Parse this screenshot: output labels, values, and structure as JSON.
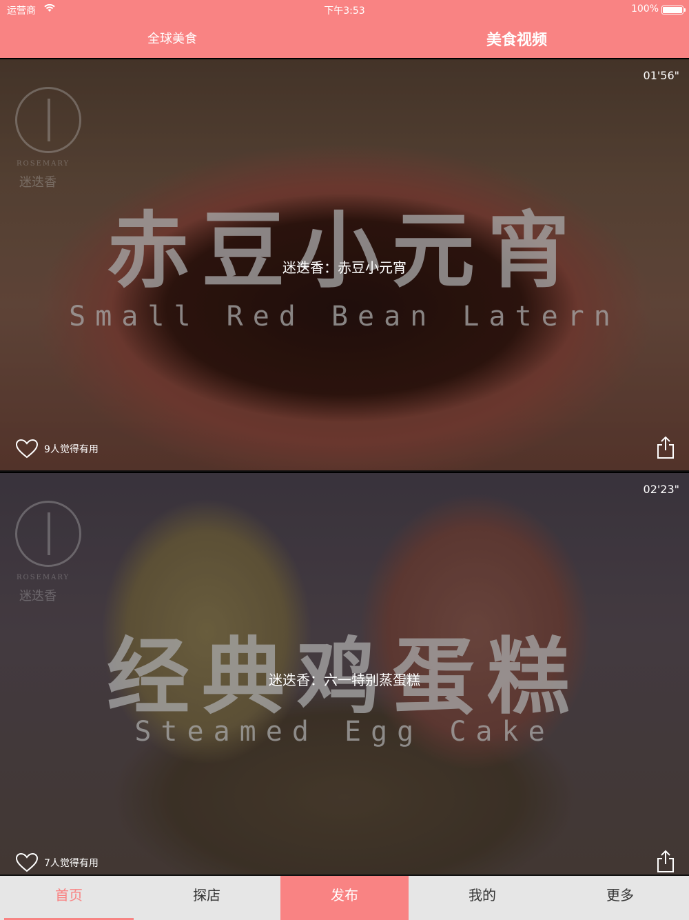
{
  "status_bar": {
    "carrier": "运营商",
    "time": "下午3:53",
    "battery": "100%"
  },
  "nav": {
    "tabs": [
      {
        "label": "全球美食"
      },
      {
        "label": "美食视频"
      }
    ],
    "active_index": 1
  },
  "videos": [
    {
      "duration": "01'56\"",
      "caption": "迷迭香：赤豆小元宵",
      "overlay_title": "赤豆小元宵",
      "overlay_subtitle": "Small Red Bean Latern",
      "watermark_en": "ROSEMARY",
      "watermark_cn": "迷迭香",
      "likes": "9人觉得有用"
    },
    {
      "duration": "02'23\"",
      "caption": "迷迭香：六一特别蒸蛋糕",
      "overlay_title": "经典鸡蛋糕",
      "overlay_subtitle": "Steamed Egg Cake",
      "watermark_en": "ROSEMARY",
      "watermark_cn": "迷迭香",
      "likes": "7人觉得有用"
    }
  ],
  "tabbar": {
    "items": [
      {
        "label": "首页"
      },
      {
        "label": "探店"
      },
      {
        "label": "发布"
      },
      {
        "label": "我的"
      },
      {
        "label": "更多"
      }
    ],
    "active_index": 0
  },
  "colors": {
    "accent": "#F98383",
    "tabbar_bg": "#E6E6E6"
  }
}
